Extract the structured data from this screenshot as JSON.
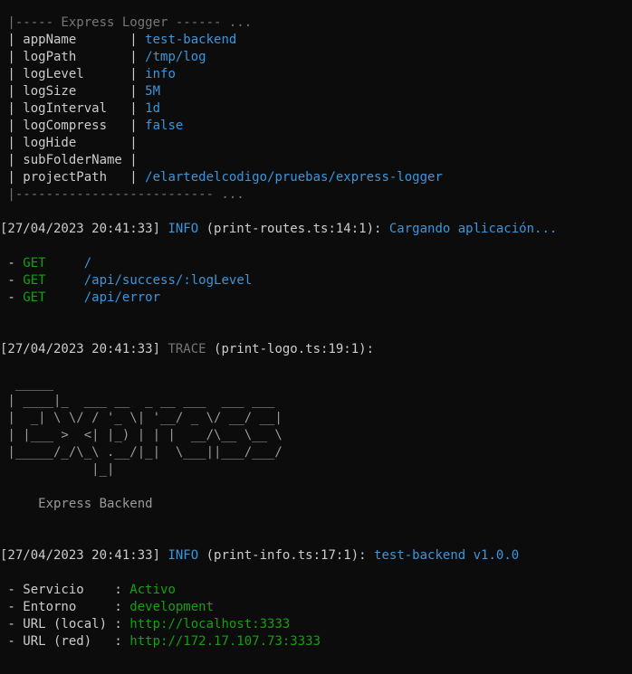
{
  "config_table": {
    "header_line": " |----- Express Logger ------ ...",
    "footer_line": " |-------------------------- ...",
    "rows": [
      {
        "label": " | appName       | ",
        "value": "test-backend"
      },
      {
        "label": " | logPath       | ",
        "value": "/tmp/log"
      },
      {
        "label": " | logLevel      | ",
        "value": "info"
      },
      {
        "label": " | logSize       | ",
        "value": "5M"
      },
      {
        "label": " | logInterval   | ",
        "value": "1d"
      },
      {
        "label": " | logCompress   | ",
        "value": "false"
      },
      {
        "label": " | logHide       | ",
        "value": ""
      },
      {
        "label": " | subFolderName | ",
        "value": ""
      },
      {
        "label": " | projectPath   | ",
        "value": "/elartedelcodigo/pruebas/express-logger"
      }
    ]
  },
  "log1": {
    "timestamp": "[27/04/2023 20:41:33] ",
    "level": "INFO",
    "source": " (print-routes.ts:14:1): ",
    "message": "Cargando aplicación..."
  },
  "routes": [
    {
      "prefix": " - ",
      "method": "GET",
      "pad": "     ",
      "path": "/"
    },
    {
      "prefix": " - ",
      "method": "GET",
      "pad": "     ",
      "path": "/api/success/:logLevel"
    },
    {
      "prefix": " - ",
      "method": "GET",
      "pad": "     ",
      "path": "/api/error"
    }
  ],
  "log2": {
    "timestamp": "[27/04/2023 20:41:33] ",
    "level": "TRACE",
    "source": " (print-logo.ts:19:1):",
    "message": ""
  },
  "logo": {
    "lines": [
      "  _____",
      " | ____|_  ___ __  _ __ ___  ___ ___",
      " |  _| \\ \\/ / '_ \\| '__/ _ \\/ __/ __|",
      " | |___ >  <| |_) | | |  __/\\__ \\__ \\",
      " |_____/_/\\_\\ .__/|_|  \\___||___/___/",
      "            |_|"
    ],
    "caption": "     Express Backend"
  },
  "log3": {
    "timestamp": "[27/04/2023 20:41:33] ",
    "level": "INFO",
    "source": " (print-info.ts:17:1): ",
    "message": "test-backend v1.0.0"
  },
  "info": [
    {
      "label": " - Servicio    : ",
      "value": "Activo"
    },
    {
      "label": " - Entorno     : ",
      "value": "development"
    },
    {
      "label": " - URL (local) : ",
      "value": "http://localhost:3333"
    },
    {
      "label": " - URL (red)   : ",
      "value": "http://172.17.107.73:3333"
    }
  ],
  "colors": {
    "background": "#0c0c0c",
    "text": "#cccccc",
    "dim": "#767676",
    "blue": "#3a96dd",
    "green": "#13a10e"
  }
}
